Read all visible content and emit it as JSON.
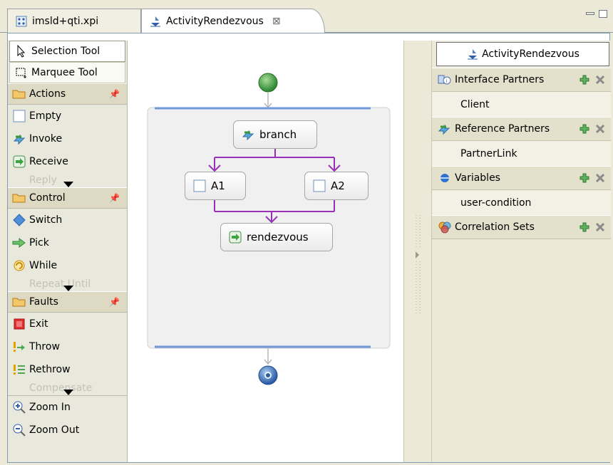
{
  "tabs": [
    {
      "label": "imsld+qti.xpi",
      "icon": "grid-file-icon"
    },
    {
      "label": "ActivityRendezvous",
      "icon": "process-icon",
      "close": "⊠"
    }
  ],
  "palette": {
    "tools": [
      {
        "label": "Selection Tool",
        "icon": "arrow-cursor-icon"
      },
      {
        "label": "Marquee Tool",
        "icon": "marquee-icon"
      }
    ],
    "drawers": [
      {
        "label": "Actions",
        "items": [
          "Empty",
          "Invoke",
          "Receive"
        ],
        "faded": "Reply"
      },
      {
        "label": "Control",
        "items": [
          "Switch",
          "Pick",
          "While"
        ],
        "faded": "Repeat Until"
      },
      {
        "label": "Faults",
        "items": [
          "Exit",
          "Throw",
          "Rethrow"
        ],
        "faded": "Compensate"
      }
    ],
    "zoom": [
      {
        "label": "Zoom In",
        "icon": "zoom-in-icon"
      },
      {
        "label": "Zoom Out",
        "icon": "zoom-out-icon"
      }
    ]
  },
  "diagram": {
    "nodes": {
      "branch": "branch",
      "a1": "A1",
      "a2": "A2",
      "rendezvous": "rendezvous"
    },
    "colors": {
      "flow": "#9b30b8",
      "connector": "#b8b8b8",
      "seq_bar": "#6e98d8",
      "start": "#3f9a3f",
      "end": "#2c5da8"
    }
  },
  "outline": {
    "title": "ActivityRendezvous",
    "sections": [
      {
        "label": "Interface Partners",
        "entry": "Client",
        "icon": "interface-icon"
      },
      {
        "label": "Reference Partners",
        "entry": "PartnerLink",
        "icon": "partner-icon"
      },
      {
        "label": "Variables",
        "entry": "user-condition",
        "icon": "variable-icon"
      },
      {
        "label": "Correlation Sets",
        "entry": "",
        "icon": "correlation-icon"
      }
    ]
  }
}
